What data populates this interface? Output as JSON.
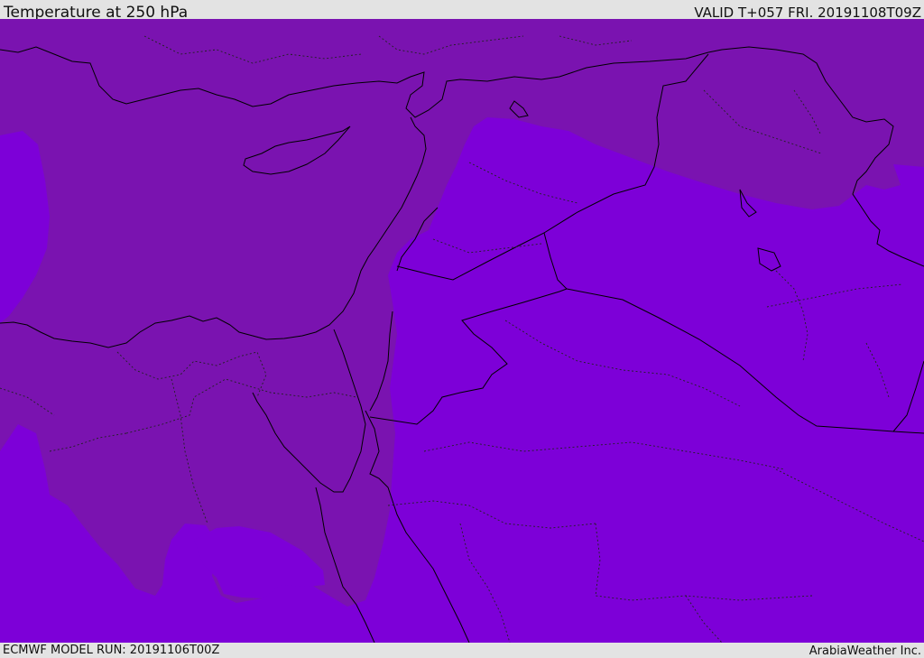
{
  "header": {
    "title": "Temperature at 250 hPa",
    "valid": "VALID T+057 FRI. 20191108T09Z"
  },
  "footer": {
    "model_run": "ECMWF MODEL RUN: 20191106T00Z",
    "credit": "ArabiaWeather Inc."
  },
  "map": {
    "colors": {
      "warm_band": "#7a13b0",
      "cold_band": "#7d00d8",
      "borders": "#000000"
    }
  }
}
